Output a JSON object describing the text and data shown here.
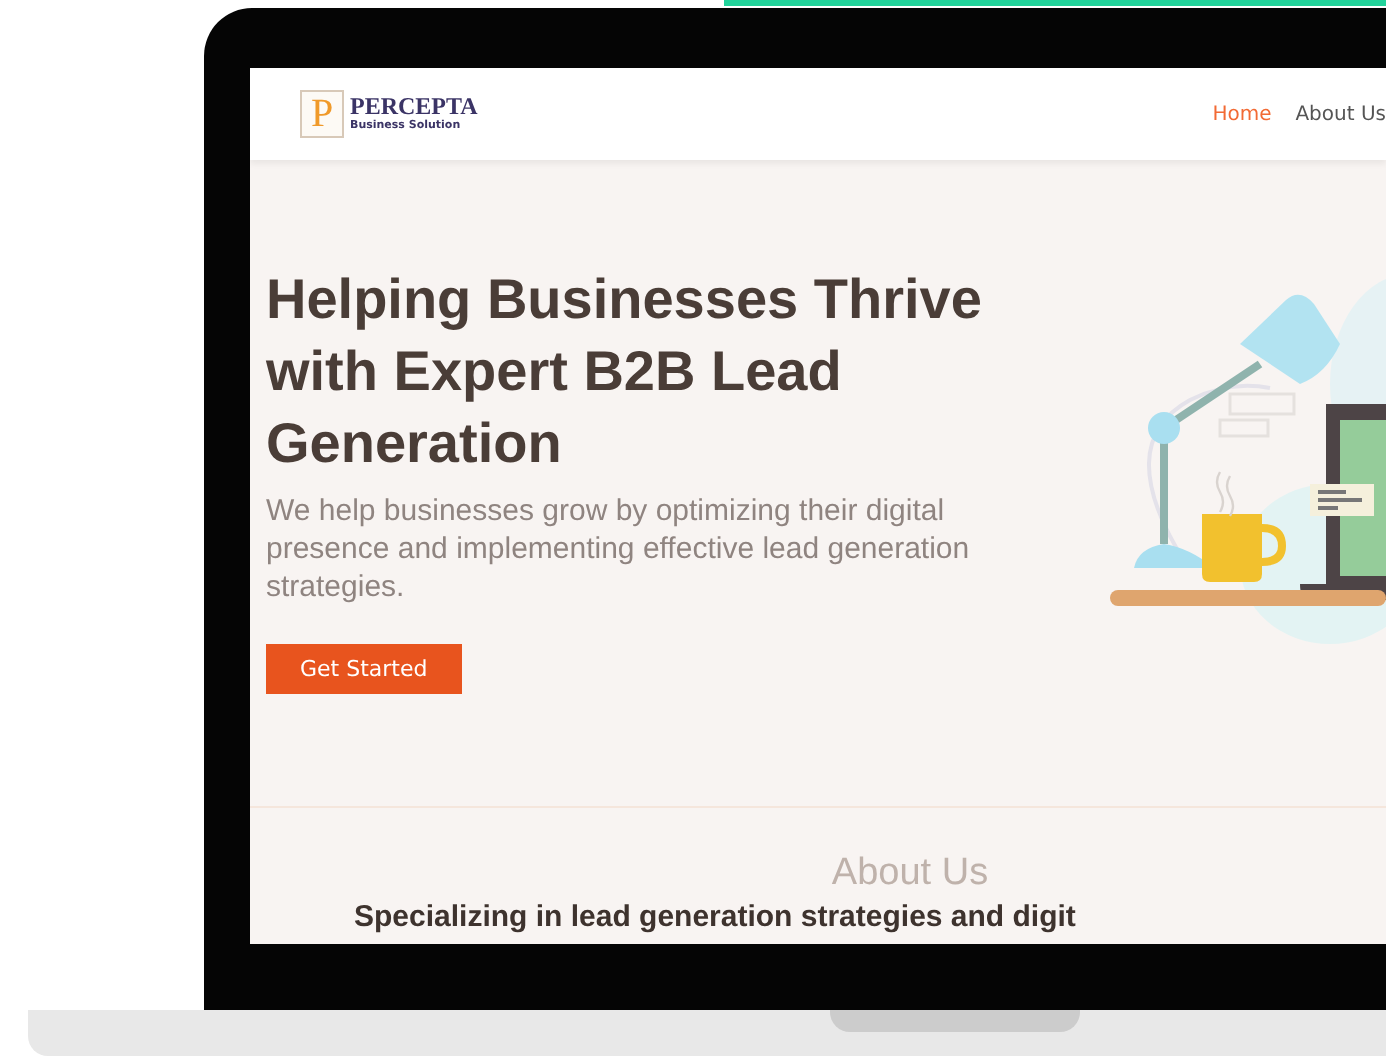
{
  "logo": {
    "mark": "P",
    "name": "PERCEPTA",
    "tagline": "Business Solution"
  },
  "nav": [
    {
      "label": "Home",
      "selected": true
    },
    {
      "label": "About Us",
      "selected": false
    }
  ],
  "hero": {
    "title": "Helping Businesses Thrive with Expert B2B Lead Generation",
    "text": "We help businesses grow by optimizing their digital presence and implementing effective lead generation strategies.",
    "button": "Get Started"
  },
  "about": {
    "heading": "About Us",
    "subheading": "Specializing in lead generation strategies and digit"
  }
}
